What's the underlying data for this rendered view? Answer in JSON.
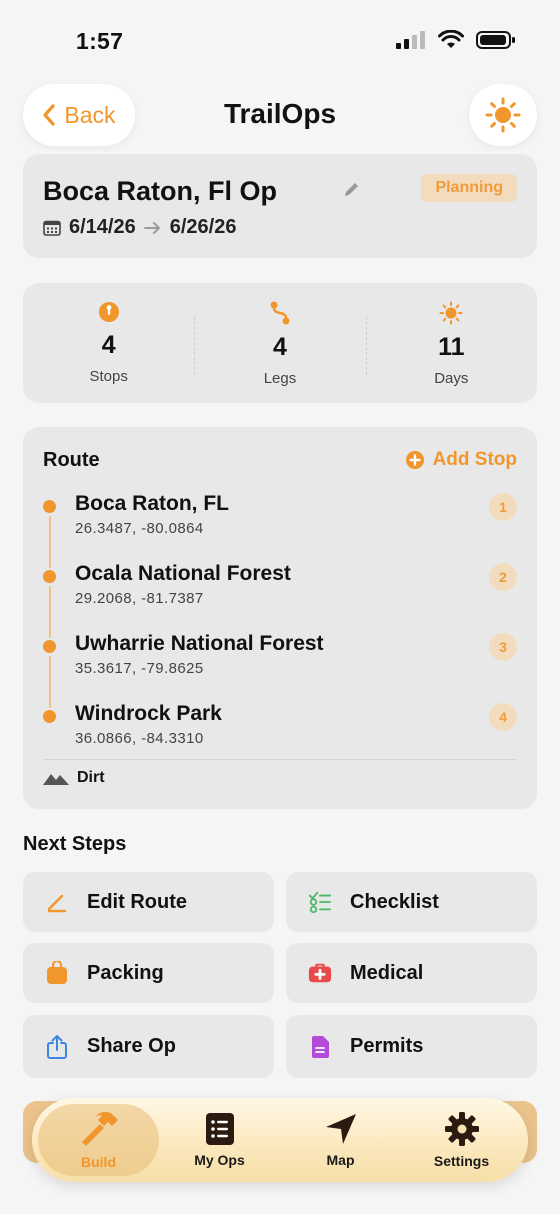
{
  "status": {
    "time": "1:57"
  },
  "nav": {
    "back_label": "Back",
    "title": "TrailOps"
  },
  "op": {
    "name": "Boca Raton, Fl Op",
    "status": "Planning",
    "start_date": "6/14/26",
    "end_date": "6/26/26"
  },
  "stats": [
    {
      "value": "4",
      "label": "Stops"
    },
    {
      "value": "4",
      "label": "Legs"
    },
    {
      "value": "11",
      "label": "Days"
    }
  ],
  "route": {
    "title": "Route",
    "add_label": "Add Stop",
    "stops": [
      {
        "name": "Boca Raton, FL",
        "coords": "26.3487, -80.0864",
        "num": "1"
      },
      {
        "name": "Ocala National Forest",
        "coords": "29.2068, -81.7387",
        "num": "2"
      },
      {
        "name": "Uwharrie National Forest",
        "coords": "35.3617, -79.8625",
        "num": "3"
      },
      {
        "name": "Windrock Park",
        "coords": "36.0866, -84.3310",
        "num": "4"
      }
    ],
    "terrain": "Dirt"
  },
  "next_steps": {
    "title": "Next Steps",
    "actions": [
      {
        "label": "Edit Route",
        "icon": "pencil-icon"
      },
      {
        "label": "Checklist",
        "icon": "checklist-icon"
      },
      {
        "label": "Packing",
        "icon": "bag-icon"
      },
      {
        "label": "Medical",
        "icon": "medical-kit-icon"
      },
      {
        "label": "Share Op",
        "icon": "share-icon"
      },
      {
        "label": "Permits",
        "icon": "document-icon"
      }
    ]
  },
  "tabs": [
    {
      "label": "Build",
      "icon": "hammer-icon",
      "active": true
    },
    {
      "label": "My Ops",
      "icon": "list-icon"
    },
    {
      "label": "Map",
      "icon": "location-arrow-icon"
    },
    {
      "label": "Settings",
      "icon": "gear-icon"
    }
  ],
  "colors": {
    "accent": "#f0962c",
    "card": "#e8e8e8",
    "background": "#f5f5f5"
  }
}
